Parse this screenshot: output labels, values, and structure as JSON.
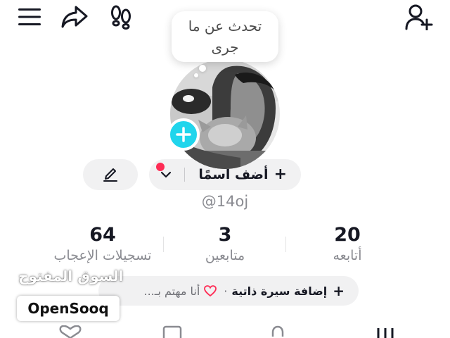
{
  "topbar": {
    "menu_icon": "hamburger-menu-icon",
    "share_icon": "share-arrow-icon",
    "footsteps_icon": "footprints-icon",
    "add_friend_icon": "add-user-icon"
  },
  "note_bubble": {
    "text": "تحدث عن ما جرى"
  },
  "avatar": {
    "add_icon": "plus-icon"
  },
  "profile": {
    "add_name_label": "أضف اسمًا",
    "add_name_plus": "+",
    "username": "@14oj",
    "edit_icon": "pencil-icon",
    "chevron_icon": "chevron-down-icon"
  },
  "stats": {
    "likes_count": "64",
    "likes_label": "تسجيلات الإعجاب",
    "followers_count": "3",
    "followers_label": "متابعين",
    "following_count": "20",
    "following_label": "أتابعه"
  },
  "bio": {
    "interests_text": "أنا مهتم بـ...",
    "separator": "·",
    "add_bio_text": "إضافة سيرة ذاتية",
    "plus": "+"
  },
  "watermark": {
    "arabic": "السوق المفتوح",
    "logo": "OpenSooq"
  },
  "colors": {
    "accent_cyan": "#20d5ec",
    "accent_red": "#fe2c55",
    "pill_bg": "#f1f1f2",
    "muted_text": "#8a8b91"
  }
}
